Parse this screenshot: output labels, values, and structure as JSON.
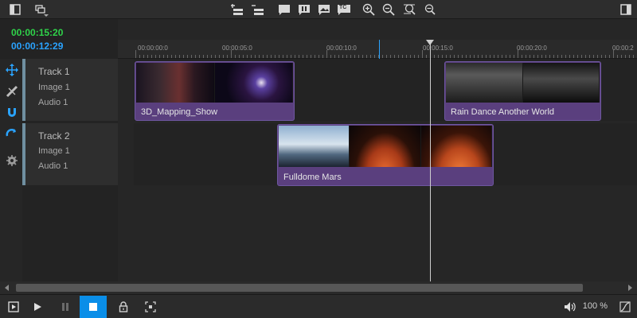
{
  "timecodes": {
    "current": "00:00:15:20",
    "duration": "00:00:12:29"
  },
  "colors": {
    "current_tc": "#2fd44a",
    "duration_tc": "#2aa3ff",
    "clip": "#5a3f7e",
    "accent": "#0a8ee8"
  },
  "ruler": {
    "labels": [
      "00:00:00:0",
      "00:00:05:0",
      "00:00:10:0",
      "00:00:15:0",
      "00:00:20:0",
      "00:00:2"
    ]
  },
  "toolbar": {
    "icons": [
      "layout-left-icon",
      "layers-menu-icon",
      "insert-track-icon",
      "remove-track-icon",
      "flag-icon",
      "pause-marker-icon",
      "image-marker-icon",
      "timecode-icon",
      "zoom-in-icon",
      "zoom-out-icon",
      "zoom-fit-icon",
      "zoom-reset-icon",
      "layout-right-icon"
    ],
    "timecode_button": "TC"
  },
  "tracks": [
    {
      "name": "Track 1",
      "image": "Image 1",
      "audio": "Audio 1",
      "clips": [
        {
          "label": "3D_Mapping_Show"
        },
        {
          "label": "Rain Dance Another World"
        }
      ]
    },
    {
      "name": "Track 2",
      "image": "Image 1",
      "audio": "Audio 1",
      "clips": [
        {
          "label": "Fulldome Mars"
        }
      ]
    }
  ],
  "tools": [
    "move-tool-icon",
    "cut-tool-icon",
    "magnet-tool-icon",
    "snap-tool-icon",
    "settings-icon"
  ],
  "bottom": {
    "volume": "100 %"
  }
}
